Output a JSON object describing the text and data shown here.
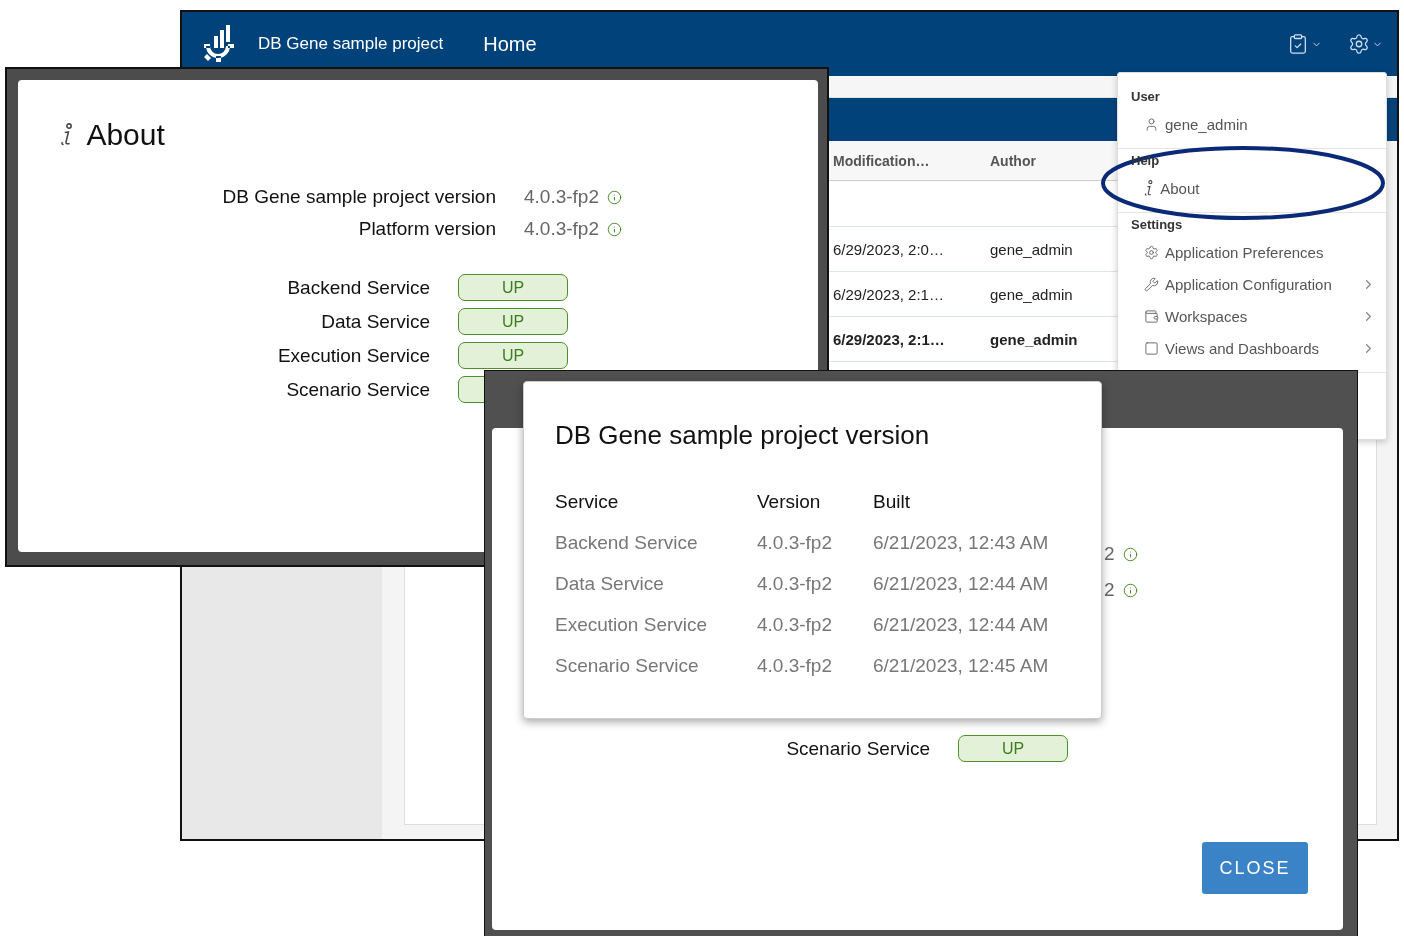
{
  "app_window": {
    "header": {
      "title": "DB Gene sample project",
      "nav": "Home"
    },
    "table": {
      "columns": [
        "Modification…",
        "Author"
      ],
      "rows": [
        {
          "modified": "6/29/2023, 2:0…",
          "author": "gene_admin",
          "selected": false
        },
        {
          "modified": "6/29/2023, 2:1…",
          "author": "gene_admin",
          "selected": false
        },
        {
          "modified": "6/29/2023, 2:1…",
          "author": "gene_admin",
          "selected": true
        }
      ]
    },
    "menu": {
      "sections": [
        {
          "title": "User",
          "circled": false,
          "items": [
            {
              "label": "gene_admin",
              "kind": "user",
              "submenu": false
            }
          ]
        },
        {
          "title": "Help",
          "circled": true,
          "items": [
            {
              "label": "About",
              "kind": "info",
              "submenu": false
            }
          ]
        },
        {
          "title": "Settings",
          "circled": false,
          "items": [
            {
              "label": "Application Preferences",
              "kind": "preferences",
              "submenu": false
            },
            {
              "label": "Application Configuration",
              "kind": "configuration",
              "submenu": true
            },
            {
              "label": "Workspaces",
              "kind": "workspaces",
              "submenu": true
            },
            {
              "label": "Views and Dashboards",
              "kind": "views",
              "submenu": true
            }
          ]
        }
      ]
    }
  },
  "about_dialog": {
    "title": "About",
    "versions": [
      {
        "label": "DB Gene sample project version",
        "value": "4.0.3-fp2"
      },
      {
        "label": "Platform version",
        "value": "4.0.3-fp2"
      }
    ],
    "services": [
      {
        "name": "Backend Service",
        "status": "UP"
      },
      {
        "name": "Data Service",
        "status": "UP"
      },
      {
        "name": "Execution Service",
        "status": "UP"
      },
      {
        "name": "Scenario Service"
      }
    ]
  },
  "version_dialog": {
    "version_fragments": [
      "2",
      "2"
    ],
    "services": [
      {
        "name": "Scenario Service",
        "status": "UP"
      }
    ],
    "close_button": "CLOSE",
    "popover": {
      "title": "DB Gene sample project version",
      "columns": [
        "Service",
        "Version",
        "Built"
      ],
      "rows": [
        {
          "service": "Backend Service",
          "version": "4.0.3-fp2",
          "built": "6/21/2023, 12:43 AM"
        },
        {
          "service": "Data Service",
          "version": "4.0.3-fp2",
          "built": "6/21/2023, 12:44 AM"
        },
        {
          "service": "Execution Service",
          "version": "4.0.3-fp2",
          "built": "6/21/2023, 12:44 AM"
        },
        {
          "service": "Scenario Service",
          "version": "4.0.3-fp2",
          "built": "6/21/2023, 12:45 AM"
        }
      ]
    }
  }
}
